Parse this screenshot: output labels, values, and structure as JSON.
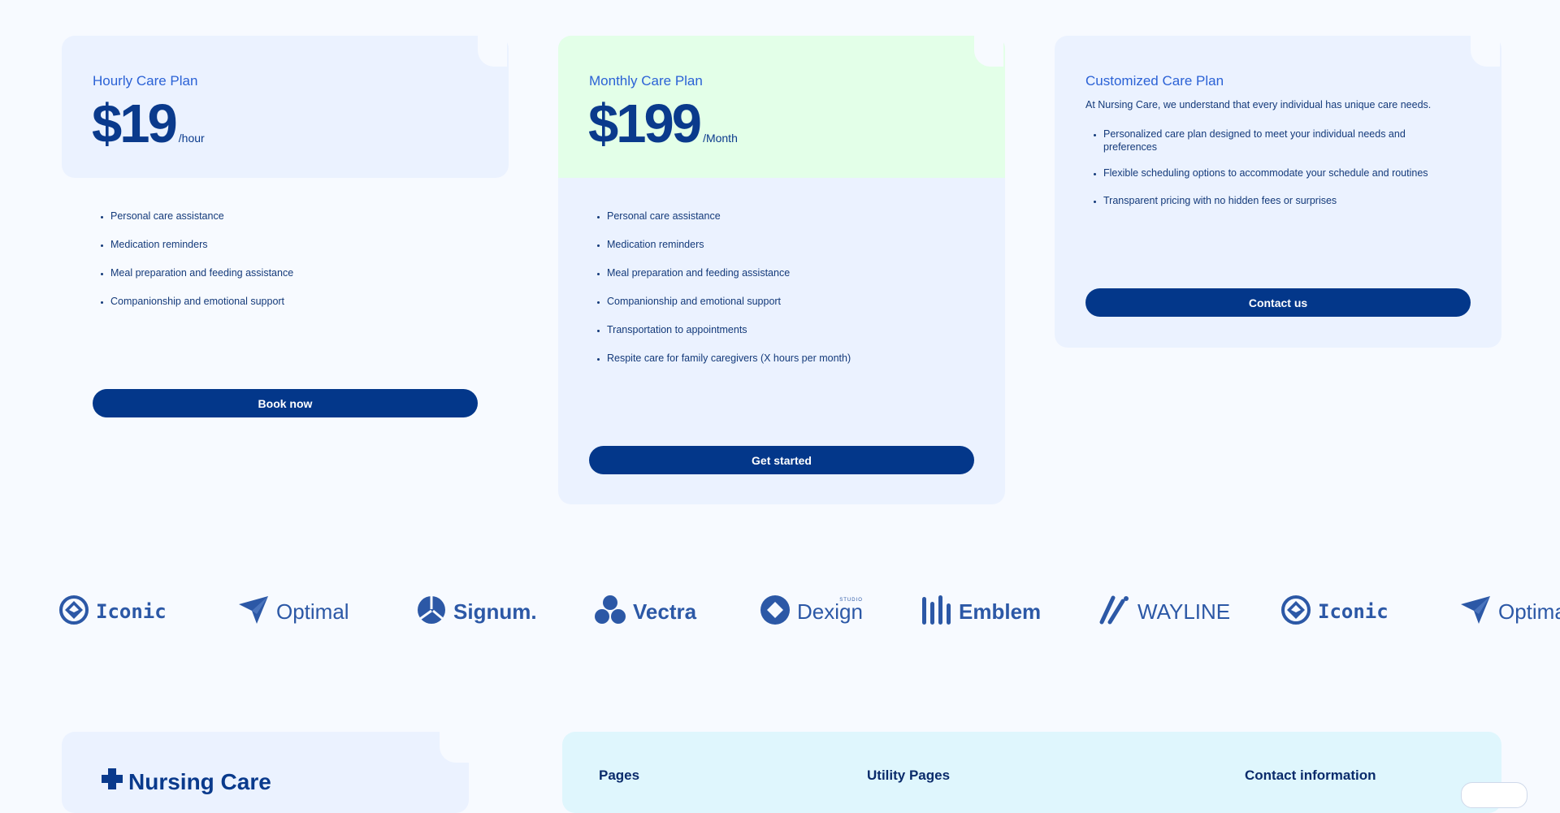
{
  "plans": [
    {
      "title": "Hourly Care Plan",
      "price": "$19",
      "unit": "/hour",
      "features": [
        "Personal care assistance",
        "Medication reminders",
        "Meal preparation and feeding assistance",
        "Companionship and emotional support"
      ],
      "button": "Book now"
    },
    {
      "title": "Monthly Care Plan",
      "price": "$199",
      "unit": "/Month",
      "features": [
        "Personal care assistance",
        "Medication reminders",
        "Meal preparation and feeding assistance",
        "Companionship and emotional support",
        "Transportation to appointments",
        "Respite care for family caregivers (X hours per month)"
      ],
      "button": "Get started"
    },
    {
      "title": "Customized Care Plan",
      "intro": "At Nursing Care, we understand that every individual has unique care needs.",
      "features": [
        "Personalized care plan designed to meet your individual needs and preferences",
        "Flexible scheduling options to accommodate your schedule and routines",
        "Transparent pricing with no hidden fees or surprises"
      ],
      "button": "Contact us"
    }
  ],
  "logos": [
    {
      "name": "Iconic",
      "icon": "compass-diamond-icon"
    },
    {
      "name": "Optimal",
      "icon": "paper-plane-icon"
    },
    {
      "name": "Signum.",
      "icon": "aperture-icon"
    },
    {
      "name": "Vectra",
      "icon": "three-circles-icon"
    },
    {
      "name": "Dexign",
      "tag": "STUDIO",
      "icon": "diamond-circle-icon"
    },
    {
      "name": "Emblem",
      "icon": "bars-icon"
    },
    {
      "name": "WAYLINE",
      "icon": "slashes-icon"
    },
    {
      "name": "Iconic",
      "icon": "compass-diamond-icon"
    },
    {
      "name": "Optimal",
      "icon": "paper-plane-icon"
    }
  ],
  "footer": {
    "brand": "Nursing Care",
    "columns": [
      "Pages",
      "Utility Pages",
      "Contact information"
    ]
  },
  "colors": {
    "background": "#f7faff",
    "card": "#ebf2ff",
    "highlight": "#e3ffe8",
    "button": "#03378a",
    "accent": "#2b62d6"
  }
}
